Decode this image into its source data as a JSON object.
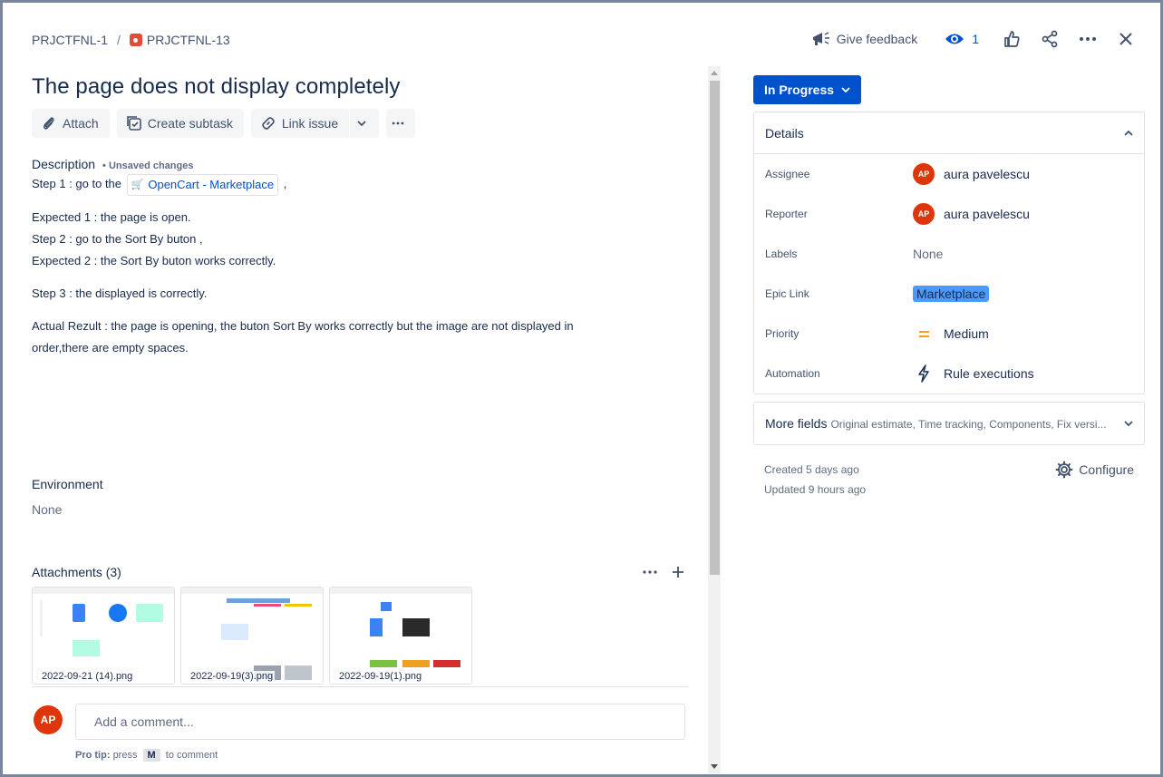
{
  "breadcrumb": {
    "parent": "PRJCTFNL-1",
    "separator": "/",
    "issue": "PRJCTFNL-13"
  },
  "header": {
    "feedback_label": "Give feedback",
    "watchers_count": "1"
  },
  "issue": {
    "title": "The page does not display completely",
    "toolbar": {
      "attach": "Attach",
      "create_subtask": "Create subtask",
      "link_issue": "Link issue"
    },
    "description": {
      "heading": "Description",
      "unsaved": "• Unsaved changes",
      "step1_prefix": "Step 1 : go to the",
      "step1_link": "OpenCart - Marketplace",
      "step1_suffix": ",",
      "expected1": "Expected 1 : the page is open.",
      "step2": "Step 2 : go to the Sort By buton ,",
      "expected2": "Expected 2 : the Sort By buton works correctly.",
      "step3": "Step 3 : the displayed is correctly.",
      "actual": "Actual Rezult : the page is opening, the buton Sort By works correctly but the image are not displayed in order,there are empty spaces."
    },
    "environment": {
      "heading": "Environment",
      "value": "None"
    },
    "attachments": {
      "heading": "Attachments (3)",
      "files": [
        "2022-09-21 (14).png",
        "2022-09-19(3).png",
        "2022-09-19(1).png"
      ]
    },
    "comment": {
      "avatar": "AP",
      "placeholder": "Add a comment...",
      "protip_label": "Pro tip:",
      "protip_text1": "press",
      "protip_key": "M",
      "protip_text2": "to comment"
    }
  },
  "sidebar": {
    "status": "In Progress",
    "details_heading": "Details",
    "fields": {
      "assignee": {
        "label": "Assignee",
        "initials": "AP",
        "value": "aura pavelescu"
      },
      "reporter": {
        "label": "Reporter",
        "initials": "AP",
        "value": "aura pavelescu"
      },
      "labels": {
        "label": "Labels",
        "value": "None"
      },
      "epic": {
        "label": "Epic Link",
        "value": "Marketplace"
      },
      "priority": {
        "label": "Priority",
        "value": "Medium"
      },
      "automation": {
        "label": "Automation",
        "value": "Rule executions"
      }
    },
    "more_fields": {
      "label": "More fields",
      "summary": "Original estimate, Time tracking, Components, Fix versi..."
    },
    "created": "Created 5 days ago",
    "updated": "Updated 9 hours ago",
    "configure": "Configure"
  },
  "colors": {
    "brand": "#0052cc",
    "avatar": "#de350b",
    "epic": "#4c9aff",
    "priority_medium": "#ff991f",
    "bug": "#e5493a"
  }
}
